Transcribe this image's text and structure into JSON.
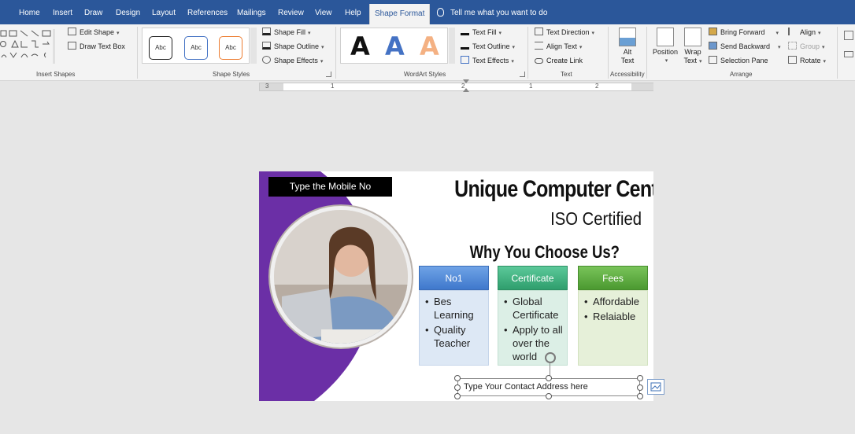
{
  "tabs": [
    "Home",
    "Insert",
    "Draw",
    "Design",
    "Layout",
    "References",
    "Mailings",
    "Review",
    "View",
    "Help",
    "Shape Format"
  ],
  "active_tab": "Shape Format",
  "tell_me": "Tell me what you want to do",
  "ribbon": {
    "insert_shapes": {
      "label": "Insert Shapes",
      "edit_shape": "Edit Shape",
      "draw_text_box": "Draw Text Box"
    },
    "shape_styles": {
      "label": "Shape Styles",
      "sample": "Abc",
      "shape_fill": "Shape Fill",
      "shape_outline": "Shape Outline",
      "shape_effects": "Shape Effects"
    },
    "wordart_styles": {
      "label": "WordArt Styles",
      "letter": "A",
      "text_fill": "Text Fill",
      "text_outline": "Text Outline",
      "text_effects": "Text Effects"
    },
    "text": {
      "label": "Text",
      "text_direction": "Text Direction",
      "align_text": "Align Text",
      "create_link": "Create Link"
    },
    "accessibility": {
      "label": "Accessibility",
      "alt_text_line1": "Alt",
      "alt_text_line2": "Text"
    },
    "arrange": {
      "label": "Arrange",
      "position": "Position",
      "wrap_text_line1": "Wrap",
      "wrap_text_line2": "Text",
      "bring_forward": "Bring Forward",
      "send_backward": "Send Backward",
      "selection_pane": "Selection Pane",
      "align": "Align",
      "group": "Group",
      "rotate": "Rotate"
    }
  },
  "ruler": {
    "labels": [
      "3",
      "1",
      "2",
      "1",
      "2"
    ]
  },
  "document": {
    "mobile_box": "Type the Mobile No",
    "title": "Unique Computer Centre",
    "subtitle": "ISO Certified",
    "why": "Why You Choose Us?",
    "columns": [
      {
        "heading": "No1",
        "items": [
          "Bes Learning",
          "Quality Teacher"
        ]
      },
      {
        "heading": "Certificate",
        "items": [
          "Global Certificate",
          "Apply to all over the world"
        ]
      },
      {
        "heading": "Fees",
        "items": [
          "Affordable",
          "Relaiable"
        ]
      }
    ],
    "contact_placeholder": "Type Your Contact Address here"
  },
  "colors": {
    "title_bar": "#2b579a",
    "purple": "#6b2fa6",
    "col1_head": "#4a86d9",
    "col1_body": "#dde8f5",
    "col2_head": "#3fb07f",
    "col2_body": "#dcefe6",
    "col3_head": "#5aaa3c",
    "col3_body": "#e6f0d9"
  }
}
